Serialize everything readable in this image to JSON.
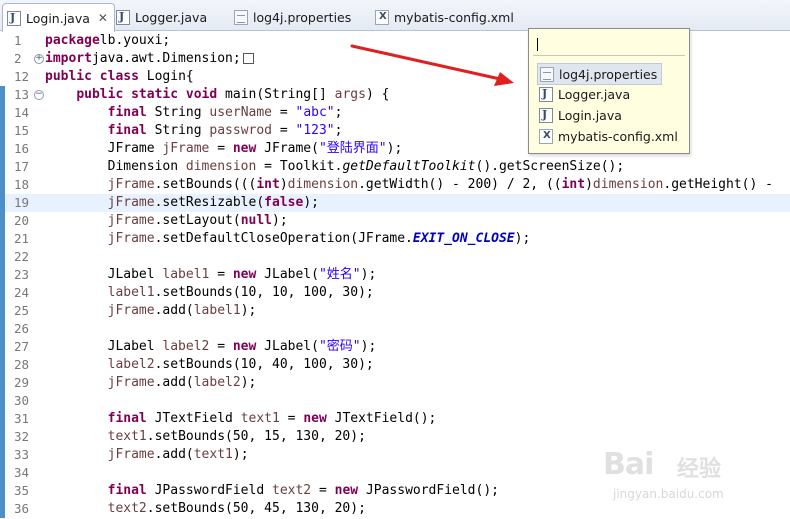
{
  "tabs": [
    {
      "label": "Login.java",
      "icon": "java-file-icon",
      "active": true
    },
    {
      "label": "Logger.java",
      "icon": "java-file-icon"
    },
    {
      "label": "log4j.properties",
      "icon": "properties-file-icon"
    },
    {
      "label": "mybatis-config.xml",
      "icon": "xml-file-icon"
    }
  ],
  "tab_close": "✕",
  "popup": {
    "input_value": "",
    "items": [
      {
        "label": "log4j.properties",
        "icon": "properties-file-icon",
        "selected": true
      },
      {
        "label": "Logger.java",
        "icon": "java-file-icon"
      },
      {
        "label": "Login.java",
        "icon": "java-file-icon"
      },
      {
        "label": "mybatis-config.xml",
        "icon": "xml-file-icon"
      }
    ]
  },
  "colors": {
    "keyword": "#7f0055",
    "string": "#2a00ff",
    "variable": "#6a3e3e",
    "static_field": "#0000c0",
    "current_line": "#e8f2fe",
    "popup_bg": "#fffee1",
    "arrow": "#e02020"
  },
  "lines": [
    {
      "n": "1",
      "tokens": [
        [
          "kw",
          "package"
        ],
        [
          "",
          "lb.youxi;"
        ]
      ]
    },
    {
      "n": "2",
      "fold": "+",
      "tokens": [
        [
          "kw",
          "import"
        ],
        [
          "",
          "java.awt.Dimension;"
        ],
        [
          "collapsed",
          ""
        ]
      ]
    },
    {
      "n": "12",
      "tokens": [
        [
          "kw",
          "public"
        ],
        [
          "",
          " "
        ],
        [
          "kw",
          "class"
        ],
        [
          "",
          " Login{"
        ]
      ]
    },
    {
      "n": "13",
      "fold": "−",
      "marker": true,
      "tokens": [
        [
          "",
          "    "
        ],
        [
          "kw",
          "public"
        ],
        [
          "",
          " "
        ],
        [
          "kw",
          "static"
        ],
        [
          "",
          " "
        ],
        [
          "kw",
          "void"
        ],
        [
          "",
          " main(String[] "
        ],
        [
          "var",
          "args"
        ],
        [
          "",
          ") {"
        ]
      ]
    },
    {
      "n": "14",
      "marker": true,
      "tokens": [
        [
          "",
          "        "
        ],
        [
          "kw",
          "final"
        ],
        [
          "",
          " String "
        ],
        [
          "var",
          "userName"
        ],
        [
          "",
          " = "
        ],
        [
          "str",
          "\"abc\""
        ],
        [
          "",
          ";"
        ]
      ]
    },
    {
      "n": "15",
      "marker": true,
      "tokens": [
        [
          "",
          "        "
        ],
        [
          "kw",
          "final"
        ],
        [
          "",
          " String "
        ],
        [
          "var",
          "passwrod"
        ],
        [
          "",
          " = "
        ],
        [
          "str",
          "\"123\""
        ],
        [
          "",
          ";"
        ]
      ]
    },
    {
      "n": "16",
      "marker": true,
      "tokens": [
        [
          "",
          "        JFrame "
        ],
        [
          "var",
          "jFrame"
        ],
        [
          "",
          " = "
        ],
        [
          "kw",
          "new"
        ],
        [
          "",
          " JFrame("
        ],
        [
          "str",
          "\"登陆界面\""
        ],
        [
          "",
          ");"
        ]
      ]
    },
    {
      "n": "17",
      "marker": true,
      "tokens": [
        [
          "",
          "        Dimension "
        ],
        [
          "var",
          "dimension"
        ],
        [
          "",
          " = Toolkit."
        ],
        [
          "it",
          "getDefaultToolkit"
        ],
        [
          "",
          "().getScreenSize();"
        ]
      ]
    },
    {
      "n": "18",
      "marker": true,
      "tokens": [
        [
          "",
          "        "
        ],
        [
          "var",
          "jFrame"
        ],
        [
          "",
          ".setBounds((("
        ],
        [
          "kw",
          "int"
        ],
        [
          "",
          ")"
        ],
        [
          "var",
          "dimension"
        ],
        [
          "",
          ".getWidth() - 200) / 2, (("
        ],
        [
          "kw",
          "int"
        ],
        [
          "",
          ")"
        ],
        [
          "var",
          "dimension"
        ],
        [
          "",
          ".getHeight() -"
        ]
      ]
    },
    {
      "n": "19",
      "marker": true,
      "current": true,
      "tokens": [
        [
          "",
          "        "
        ],
        [
          "var",
          "jFrame"
        ],
        [
          "",
          ".setResizable("
        ],
        [
          "kw",
          "false"
        ],
        [
          "",
          ");"
        ]
      ]
    },
    {
      "n": "20",
      "marker": true,
      "tokens": [
        [
          "",
          "        "
        ],
        [
          "var",
          "jFrame"
        ],
        [
          "",
          ".setLayout("
        ],
        [
          "kw",
          "null"
        ],
        [
          "",
          ");"
        ]
      ]
    },
    {
      "n": "21",
      "marker": true,
      "tokens": [
        [
          "",
          "        "
        ],
        [
          "var",
          "jFrame"
        ],
        [
          "",
          ".setDefaultCloseOperation(JFrame."
        ],
        [
          "sf",
          "EXIT_ON_CLOSE"
        ],
        [
          "",
          ");"
        ]
      ]
    },
    {
      "n": "22",
      "marker": true,
      "tokens": [
        [
          "",
          ""
        ]
      ]
    },
    {
      "n": "23",
      "marker": true,
      "tokens": [
        [
          "",
          "        JLabel "
        ],
        [
          "var",
          "label1"
        ],
        [
          "",
          " = "
        ],
        [
          "kw",
          "new"
        ],
        [
          "",
          " JLabel("
        ],
        [
          "str",
          "\"姓名\""
        ],
        [
          "",
          ");"
        ]
      ]
    },
    {
      "n": "24",
      "marker": true,
      "tokens": [
        [
          "",
          "        "
        ],
        [
          "var",
          "label1"
        ],
        [
          "",
          ".setBounds(10, 10, 100, 30);"
        ]
      ]
    },
    {
      "n": "25",
      "marker": true,
      "tokens": [
        [
          "",
          "        "
        ],
        [
          "var",
          "jFrame"
        ],
        [
          "",
          ".add("
        ],
        [
          "var",
          "label1"
        ],
        [
          "",
          ");"
        ]
      ]
    },
    {
      "n": "26",
      "marker": true,
      "tokens": [
        [
          "",
          ""
        ]
      ]
    },
    {
      "n": "27",
      "marker": true,
      "tokens": [
        [
          "",
          "        JLabel "
        ],
        [
          "var",
          "label2"
        ],
        [
          "",
          " = "
        ],
        [
          "kw",
          "new"
        ],
        [
          "",
          " JLabel("
        ],
        [
          "str",
          "\"密码\""
        ],
        [
          "",
          ");"
        ]
      ]
    },
    {
      "n": "28",
      "marker": true,
      "tokens": [
        [
          "",
          "        "
        ],
        [
          "var",
          "label2"
        ],
        [
          "",
          ".setBounds(10, 40, 100, 30);"
        ]
      ]
    },
    {
      "n": "29",
      "marker": true,
      "tokens": [
        [
          "",
          "        "
        ],
        [
          "var",
          "jFrame"
        ],
        [
          "",
          ".add("
        ],
        [
          "var",
          "label2"
        ],
        [
          "",
          ");"
        ]
      ]
    },
    {
      "n": "30",
      "marker": true,
      "tokens": [
        [
          "",
          ""
        ]
      ]
    },
    {
      "n": "31",
      "marker": true,
      "tokens": [
        [
          "",
          "        "
        ],
        [
          "kw",
          "final"
        ],
        [
          "",
          " JTextField "
        ],
        [
          "var",
          "text1"
        ],
        [
          "",
          " = "
        ],
        [
          "kw",
          "new"
        ],
        [
          "",
          " JTextField();"
        ]
      ]
    },
    {
      "n": "32",
      "marker": true,
      "tokens": [
        [
          "",
          "        "
        ],
        [
          "var",
          "text1"
        ],
        [
          "",
          ".setBounds(50, 15, 130, 20);"
        ]
      ]
    },
    {
      "n": "33",
      "marker": true,
      "tokens": [
        [
          "",
          "        "
        ],
        [
          "var",
          "jFrame"
        ],
        [
          "",
          ".add("
        ],
        [
          "var",
          "text1"
        ],
        [
          "",
          ");"
        ]
      ]
    },
    {
      "n": "34",
      "marker": true,
      "tokens": [
        [
          "",
          ""
        ]
      ]
    },
    {
      "n": "35",
      "marker": true,
      "tokens": [
        [
          "",
          "        "
        ],
        [
          "kw",
          "final"
        ],
        [
          "",
          " JPasswordField "
        ],
        [
          "var",
          "text2"
        ],
        [
          "",
          " = "
        ],
        [
          "kw",
          "new"
        ],
        [
          "",
          " JPasswordField();"
        ]
      ]
    },
    {
      "n": "36",
      "marker": true,
      "tokens": [
        [
          "",
          "        "
        ],
        [
          "var",
          "text2"
        ],
        [
          "",
          ".setBounds(50, 45, 130, 20);"
        ]
      ]
    }
  ],
  "watermark": {
    "brand": "Bai",
    "brand2": "经验",
    "url": "jingyan.baidu.com"
  }
}
